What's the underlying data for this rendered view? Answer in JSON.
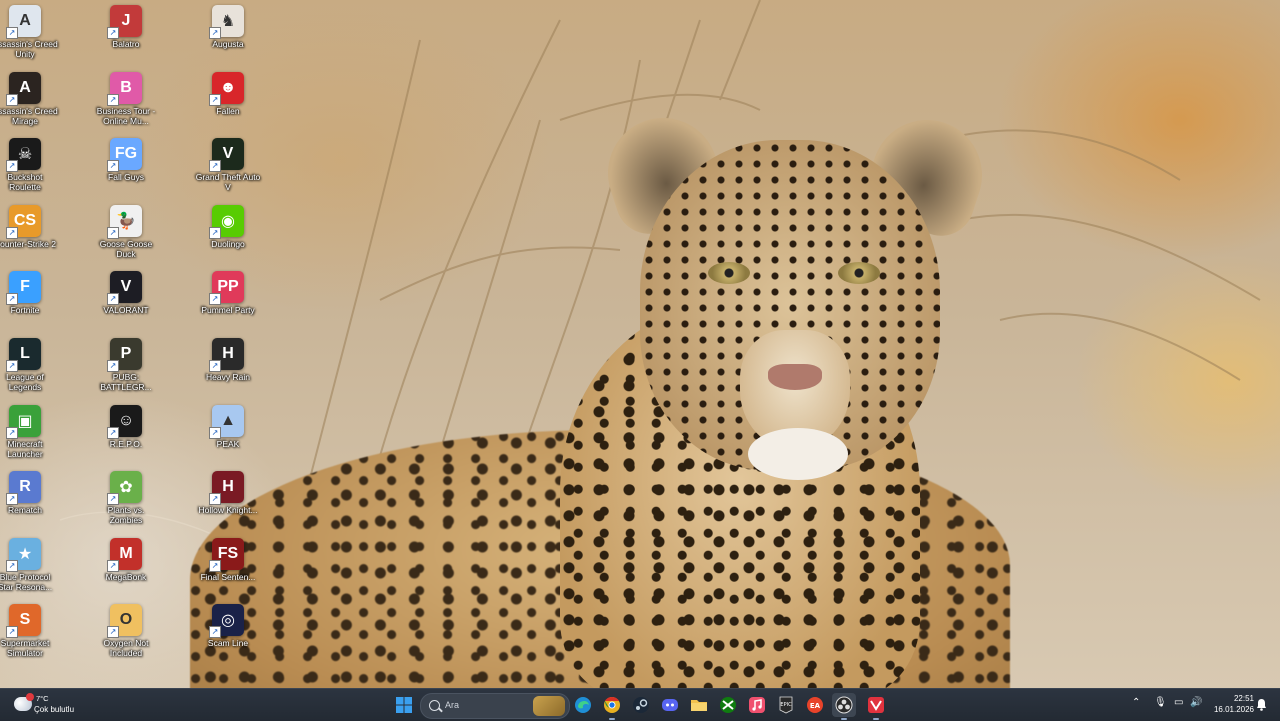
{
  "desktop": {
    "icons": [
      {
        "label": "Assassin's Creed Unity",
        "color": "#dfe6ee",
        "glyph": "A"
      },
      {
        "label": "Assassin's Creed Mirage",
        "color": "#2b2420",
        "glyph": "A"
      },
      {
        "label": "Buckshot Roulette",
        "color": "#1a1a1a",
        "glyph": "☠"
      },
      {
        "label": "Counter-Strike 2",
        "color": "#e89a2a",
        "glyph": "CS"
      },
      {
        "label": "Fortnite",
        "color": "#3aa0ff",
        "glyph": "F"
      },
      {
        "label": "League of Legends",
        "color": "#1a2a2e",
        "glyph": "L"
      },
      {
        "label": "Minecraft Launcher",
        "color": "#3aa13a",
        "glyph": "▣"
      },
      {
        "label": "Rematch",
        "color": "#5a7ad0",
        "glyph": "R"
      },
      {
        "label": "Blue Protocol Star Resona...",
        "color": "#6ab0e0",
        "glyph": "★"
      },
      {
        "label": "Supermarket Simulator",
        "color": "#e0682a",
        "glyph": "S"
      },
      {
        "label": "Balatro",
        "color": "#c23a3a",
        "glyph": "J"
      },
      {
        "label": "Business Tour - Online Mu...",
        "color": "#e05aa8",
        "glyph": "B"
      },
      {
        "label": "Fall Guys",
        "color": "#6aa8ff",
        "glyph": "FG"
      },
      {
        "label": "Goose Goose Duck",
        "color": "#f0f0f0",
        "glyph": "🦆"
      },
      {
        "label": "VALORANT",
        "color": "#1d1d24",
        "glyph": "V"
      },
      {
        "label": "PUBG: BATTLEGR...",
        "color": "#3a3a2e",
        "glyph": "P"
      },
      {
        "label": "R.E.P.O.",
        "color": "#1a1a1a",
        "glyph": "☺"
      },
      {
        "label": "Plants vs. Zombies",
        "color": "#6ab04a",
        "glyph": "✿"
      },
      {
        "label": "MegaBonk",
        "color": "#c2302a",
        "glyph": "M"
      },
      {
        "label": "Oxygen Not Included",
        "color": "#f0c060",
        "glyph": "O"
      },
      {
        "label": "Augusta",
        "color": "#e8e2da",
        "glyph": "♞"
      },
      {
        "label": "Fallen",
        "color": "#d8262a",
        "glyph": "☻"
      },
      {
        "label": "Grand Theft Auto V",
        "color": "#1c2a1c",
        "glyph": "V"
      },
      {
        "label": "Duolingo",
        "color": "#58cc02",
        "glyph": "◉"
      },
      {
        "label": "Pummel Party",
        "color": "#e03a5a",
        "glyph": "PP"
      },
      {
        "label": "Heavy Rain",
        "color": "#2a2a2a",
        "glyph": "H"
      },
      {
        "label": "PEAK",
        "color": "#a8c8f0",
        "glyph": "▲"
      },
      {
        "label": "Hollow Knight...",
        "color": "#7a1a24",
        "glyph": "H"
      },
      {
        "label": "Final Senten...",
        "color": "#8a1a1a",
        "glyph": "FS"
      },
      {
        "label": "Scam Line",
        "color": "#1a2248",
        "glyph": "◎"
      }
    ]
  },
  "taskbar": {
    "weather": {
      "temp": "7°C",
      "condition": "Çok bulutlu"
    },
    "search": {
      "placeholder": "Ara"
    },
    "apps": [
      {
        "name": "start-button",
        "color": "#3a9be8"
      },
      {
        "name": "edge-icon",
        "color": "#1f8fd6"
      },
      {
        "name": "chrome-icon",
        "color": "#e8b020"
      },
      {
        "name": "steam-icon",
        "color": "#c6d4df"
      },
      {
        "name": "discord-icon",
        "color": "#5865f2"
      },
      {
        "name": "file-explorer-icon",
        "color": "#f2c14e"
      },
      {
        "name": "xbox-icon",
        "color": "#1f9e3a"
      },
      {
        "name": "music-icon",
        "color": "#f0506e"
      },
      {
        "name": "epic-games-icon",
        "color": "#2a2a2a"
      },
      {
        "name": "ea-icon",
        "color": "#e8432a"
      },
      {
        "name": "obs-icon",
        "color": "#3a3a3a"
      },
      {
        "name": "valorant-icon",
        "color": "#e0323e"
      }
    ],
    "clock": {
      "time": "22:51",
      "date": "16.01.2026"
    }
  }
}
